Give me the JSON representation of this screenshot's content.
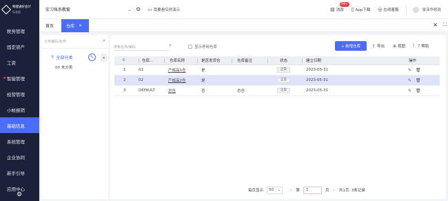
{
  "logo": {
    "title": "畅捷通好会计",
    "subtitle": "标准版"
  },
  "sidebar": {
    "items": [
      {
        "label": "税务管理"
      },
      {
        "label": "固定资产"
      },
      {
        "label": "工资"
      },
      {
        "label": "智能管理"
      },
      {
        "label": "经营管理"
      },
      {
        "label": "小帐报销"
      },
      {
        "label": "基础信息"
      },
      {
        "label": "系统管理"
      },
      {
        "label": "企业协同"
      },
      {
        "label": "新手引导"
      },
      {
        "label": "应用中心"
      }
    ]
  },
  "topbar": {
    "account": "实习账系教套",
    "demo_text": "我要看实例演示",
    "messages": "消息",
    "badge": "99+",
    "app_download": "App下载",
    "online_service": "在线客服",
    "user": "张泽华修改"
  },
  "tabs": {
    "home": "首页",
    "active": "仓库",
    "close_mark": "×"
  },
  "left_panel": {
    "search_placeholder": "分类编码/名称",
    "tree_root": "全部分类",
    "tree_child": "00 未分类"
  },
  "toolbar": {
    "search_placeholder": "搜索名称/编码",
    "show_disabled": "显示停用仓库",
    "add_button": "+ 新增仓库",
    "export": "导出",
    "view": "视图",
    "help": "帮助"
  },
  "table": {
    "headers": [
      "",
      "仓库...",
      "仓库名称",
      "是否发货仓",
      "仓库备注",
      "状态",
      "建立日期",
      "操作"
    ],
    "rows": [
      {
        "index": "1",
        "code": "01",
        "name": "产成品1仓",
        "is_ship": "是",
        "remark": "",
        "status": "正常",
        "date": "2023-05-31"
      },
      {
        "index": "2",
        "code": "02",
        "name": "产成品2仓",
        "is_ship": "是",
        "remark": "",
        "status": "正常",
        "date": "2023-05-31"
      },
      {
        "index": "3",
        "code": "DEFAULT",
        "name": "总仓",
        "is_ship": "否",
        "remark": "总仓",
        "status": "正常",
        "date": "2023-05-31"
      }
    ]
  },
  "pager": {
    "per_page_label": "每页显示",
    "per_page": "50",
    "page_prefix": "第",
    "page": "1",
    "page_suffix": "页",
    "summary": "共1页, 3条记录"
  }
}
